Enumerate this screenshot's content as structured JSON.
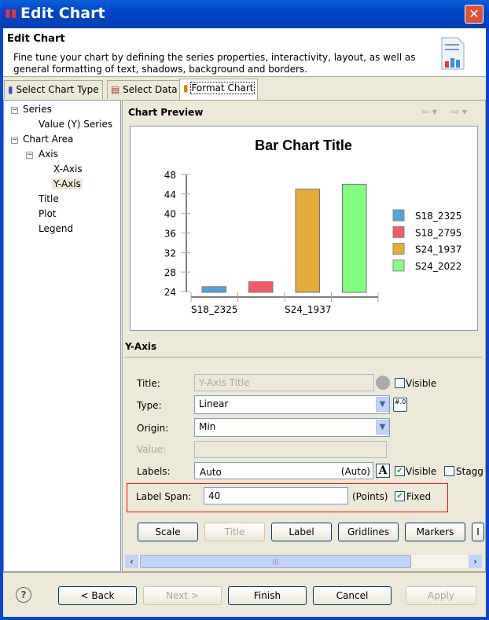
{
  "window": {
    "title": "Edit Chart",
    "close": "✕"
  },
  "header": {
    "title": "Edit Chart",
    "description": "Fine tune your chart by defining the series properties, interactivity, layout, as well as general formatting of text, shadows, background and borders."
  },
  "tabs": [
    {
      "label": "Select Chart Type"
    },
    {
      "label": "Select Data"
    },
    {
      "label": "Format Chart",
      "active": true
    }
  ],
  "tree": {
    "items": [
      "Series",
      "Value (Y) Series",
      "Chart Area",
      "Axis",
      "X-Axis",
      "Y-Axis",
      "Title",
      "Plot",
      "Legend"
    ],
    "selected": "Y-Axis"
  },
  "preview": {
    "label": "Chart Preview",
    "nav_back": "⇦ ▾",
    "nav_fwd": "⇨ ▾"
  },
  "chart_data": {
    "type": "bar",
    "title": "Bar Chart Title",
    "categories": [
      "S18_2325",
      "S18_2795",
      "S24_1937",
      "S24_2022"
    ],
    "x_tick_labels": [
      "S18_2325",
      "S24_1937"
    ],
    "values": [
      25,
      26,
      45,
      46
    ],
    "colors": [
      "#52a3db",
      "#f45a6a",
      "#e6ac3a",
      "#80ff80"
    ],
    "ylim": [
      24,
      48
    ],
    "yticks": [
      "24",
      "28",
      "32",
      "36",
      "40",
      "44",
      "48"
    ],
    "legend": {
      "position": "right",
      "entries": [
        "S18_2325",
        "S18_2795",
        "S24_1937",
        "S24_2022"
      ]
    },
    "grid": false
  },
  "yaxis": {
    "section_title": "Y-Axis",
    "title_label": "Title:",
    "title_placeholder": "Y-Axis Title",
    "title_visible_label": "Visible",
    "title_visible": false,
    "type_label": "Type:",
    "type_value": "Linear",
    "origin_label": "Origin:",
    "origin_value": "Min",
    "value_label": "Value:",
    "value_value": "",
    "labels_label": "Labels:",
    "labels_value": "Auto",
    "labels_auto": "(Auto)",
    "labels_visible_label": "Visible",
    "labels_visible": true,
    "stagger_label": "Stagg",
    "stagger": false,
    "span_label": "Label Span:",
    "span_value": "40",
    "span_unit": "(Points)",
    "fixed_label": "Fixed",
    "fixed": true,
    "highlight_color": "#ff0000",
    "buttons": [
      "Scale",
      "Title",
      "Label",
      "Gridlines",
      "Markers",
      "I"
    ]
  },
  "footer": {
    "help": "?",
    "back": "< Back",
    "next": "Next >",
    "finish": "Finish",
    "cancel": "Cancel",
    "apply": "Apply"
  }
}
